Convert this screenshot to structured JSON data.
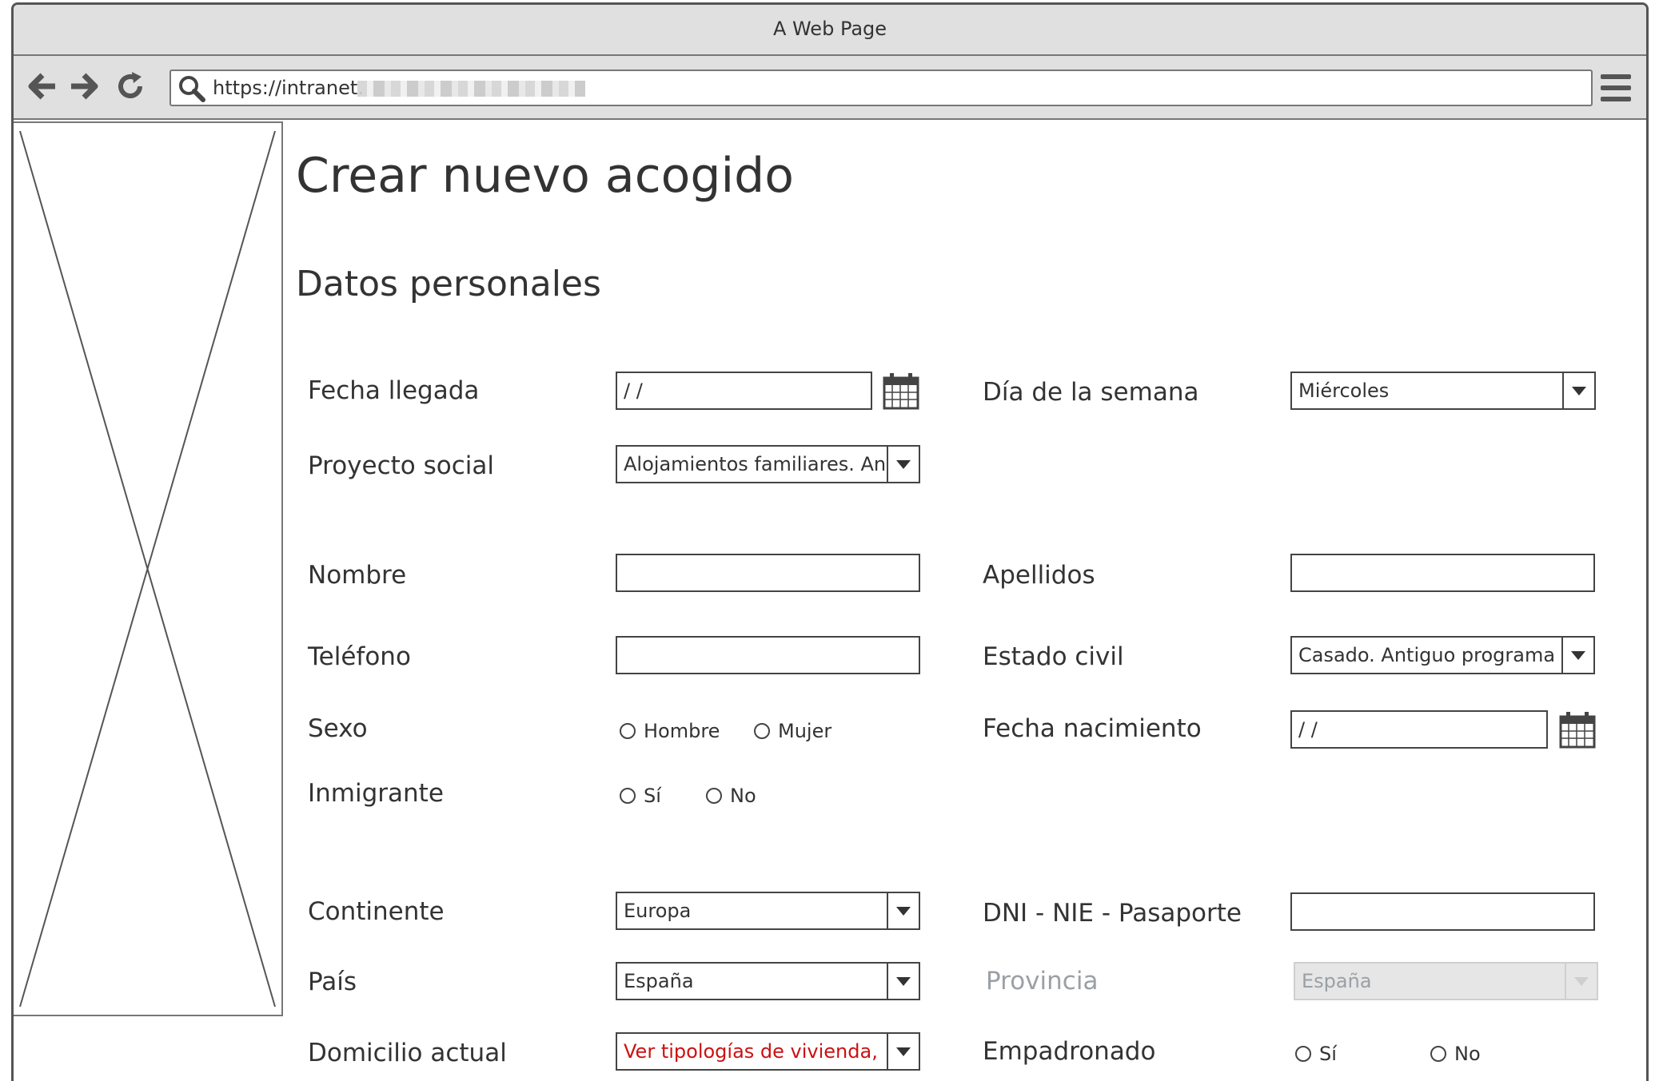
{
  "window": {
    "title": "A Web Page"
  },
  "address_bar": {
    "url": "https://intranet."
  },
  "icons": {
    "back": "arrow-left-icon",
    "forward": "arrow-right-icon",
    "reload": "reload-icon",
    "search": "search-icon",
    "menu": "hamburger-menu-icon",
    "calendar": "calendar-icon"
  },
  "page": {
    "title": "Crear nuevo acogido",
    "section_title": "Datos personales"
  },
  "form": {
    "fecha_llegada": {
      "label": "Fecha llegada",
      "value": " /  /"
    },
    "dia_semana": {
      "label": "Día de la semana",
      "value": "Miércoles"
    },
    "proyecto_social": {
      "label": "Proyecto social",
      "value": "Alojamientos familiares. Ant"
    },
    "nombre": {
      "label": "Nombre",
      "value": ""
    },
    "apellidos": {
      "label": "Apellidos",
      "value": ""
    },
    "telefono": {
      "label": "Teléfono",
      "value": ""
    },
    "estado_civil": {
      "label": "Estado civil",
      "value": "Casado. Antiguo programa"
    },
    "sexo": {
      "label": "Sexo",
      "options": [
        "Hombre",
        "Mujer"
      ]
    },
    "fecha_nacimiento": {
      "label": "Fecha nacimiento",
      "value": " /  /"
    },
    "inmigrante": {
      "label": "Inmigrante",
      "options": [
        "Sí",
        "No"
      ]
    },
    "continente": {
      "label": "Continente",
      "value": "Europa"
    },
    "dni": {
      "label": "DNI - NIE - Pasaporte",
      "value": ""
    },
    "pais": {
      "label": "País",
      "value": "España"
    },
    "provincia": {
      "label": "Provincia",
      "value": "España",
      "disabled": true
    },
    "domicilio": {
      "label": "Domicilio actual",
      "value": "Ver tipologías de vivienda,"
    },
    "empadronado": {
      "label": "Empadronado",
      "options": [
        "Sí",
        "No"
      ]
    }
  },
  "colors": {
    "chrome": "#e0e0e0",
    "border": "#444444",
    "text": "#333333",
    "warning_text": "#cc1111",
    "disabled_text": "#9aa0a6"
  }
}
